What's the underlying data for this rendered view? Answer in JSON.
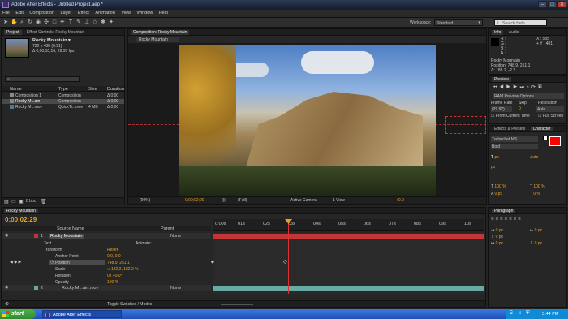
{
  "window": {
    "title": "Adobe After Effects - Untitled Project.aep *"
  },
  "menu": [
    "File",
    "Edit",
    "Composition",
    "Layer",
    "Effect",
    "Animation",
    "View",
    "Window",
    "Help"
  ],
  "toolbar": {
    "workspace_label": "Workspace:",
    "workspace_value": "Standard",
    "search_placeholder": "Search Help"
  },
  "project": {
    "tabs": [
      "Project",
      "Effect Controls: Rocky Mountain"
    ],
    "thumb_name": "Rocky Mountain ▾",
    "thumb_info1": "720 x 480 (0.91)",
    "thumb_info2": "Δ 0;00;10;16, 29.97 fps",
    "headers": [
      "Name",
      "Type",
      "Size",
      "Duration"
    ],
    "items": [
      {
        "name": "Composition 1",
        "type": "Composition",
        "size": "",
        "duration": "Δ 0;00"
      },
      {
        "name": "Rocky M...ain",
        "type": "Composition",
        "size": "",
        "duration": "Δ 0;00"
      },
      {
        "name": "Rocky M...mov",
        "type": "QuickTi...ovie",
        "size": "4 MB",
        "duration": "Δ 0;00"
      }
    ],
    "bpc": "8 bpc"
  },
  "composition": {
    "tab": "Composition: Rocky Mountain",
    "subtab": "Rocky Mountain",
    "zoom": "(99%)",
    "timecode": "0;00;02;29",
    "resolution": "(Full)",
    "camera": "Active Camera",
    "view": "1 View",
    "offset": "+0.0"
  },
  "info": {
    "tabs": [
      "Info",
      "Audio"
    ],
    "r": "R :",
    "g": "G :",
    "b": "B :",
    "a": "A :",
    "x": "X : 585",
    "y": "+ Y : 481",
    "layer": "Rocky Mountain",
    "position": "Position: 748.9, 251.1",
    "delta": "Δ: 183.2, -2.2"
  },
  "preview": {
    "tab": "Preview",
    "ram": "RAM Preview Options",
    "frame_rate_label": "Frame Rate",
    "skip_label": "Skip",
    "resolution_label": "Resolution",
    "frame_rate": "(29.97)",
    "skip": "0",
    "resolution": "Auto",
    "from_current": "From Current Time",
    "full_screen": "Full Screen"
  },
  "character": {
    "tabs": [
      "Effects & Presets",
      "Character"
    ],
    "font": "Trebuchet MS",
    "style": "Bold",
    "size": "px",
    "auto": "Auto",
    "leading": "px",
    "percent1": "100 %",
    "percent2": "100 %",
    "px1": "0 px",
    "pct3": "0 %"
  },
  "paragraph": {
    "tab": "Paragraph",
    "values": [
      "0 px",
      "0 px",
      "0 px",
      "0 px",
      "0 px"
    ]
  },
  "timeline": {
    "tab": "Rocky Mountain",
    "timecode": "0;00;02;29",
    "headers": {
      "source": "Source Name",
      "parent": "Parent"
    },
    "ruler": [
      "0:00s",
      "01s",
      "02s",
      "03s",
      "04s",
      "05s",
      "06s",
      "07s",
      "08s",
      "09s",
      "10s"
    ],
    "layers": [
      {
        "num": "1",
        "name": "Rocky Mountain",
        "parent": "None",
        "color": "#c43535"
      },
      {
        "num": "2",
        "name": "Rocky M...ain.mov",
        "parent": "None",
        "color": "#67a9a3"
      }
    ],
    "props": [
      {
        "name": "Text",
        "value": "Animate:"
      },
      {
        "name": "Transform",
        "value": "Reset"
      },
      {
        "name": "Anchor Point",
        "value": "0.0, 0.0"
      },
      {
        "name": "Position",
        "value": "748.9, 251.1"
      },
      {
        "name": "Scale",
        "value": "∞ 182.2, 182.2 %"
      },
      {
        "name": "Rotation",
        "value": "0x +0.0°"
      },
      {
        "name": "Opacity",
        "value": "100 %"
      }
    ],
    "toggle": "Toggle Switches / Modes"
  },
  "taskbar": {
    "start": "start",
    "app": "Adobe After Effects",
    "clock": "3:44 PM"
  },
  "colors": {
    "accent": "#e7a31f",
    "layer_red": "#c43535",
    "layer_teal": "#67a9a3",
    "taskbar": "#245edb",
    "start": "#3c9a3c"
  }
}
